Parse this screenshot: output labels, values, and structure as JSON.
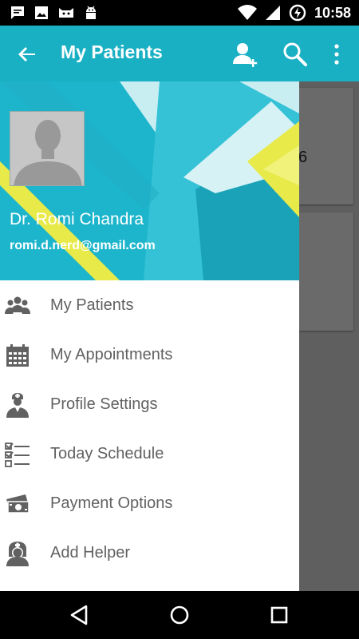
{
  "status_bar": {
    "time": "10:58",
    "left_icons": [
      "chat-icon",
      "image-icon",
      "cat-icon",
      "android-icon"
    ],
    "right_icons": [
      "wifi-icon",
      "signal-icon",
      "battery-charging-icon"
    ]
  },
  "app_bar": {
    "title": "My Patients",
    "actions": [
      "add-user-icon",
      "search-icon",
      "overflow-menu-icon"
    ]
  },
  "background": {
    "card_text": "6"
  },
  "drawer": {
    "profile": {
      "name": "Dr. Romi Chandra",
      "email": "romi.d.nerd@gmail.com"
    },
    "items": [
      {
        "label": "My Patients",
        "icon": "patients-group-icon"
      },
      {
        "label": "My Appointments",
        "icon": "calendar-icon"
      },
      {
        "label": "Profile Settings",
        "icon": "doctor-icon"
      },
      {
        "label": "Today Schedule",
        "icon": "checklist-icon"
      },
      {
        "label": "Payment Options",
        "icon": "money-icon"
      },
      {
        "label": "Add Helper",
        "icon": "nurse-icon"
      }
    ]
  },
  "nav_bar": {
    "buttons": [
      "back-icon",
      "home-icon",
      "recents-icon"
    ]
  },
  "colors": {
    "primary": "#1ab0c4",
    "icon_gray": "#616161",
    "accent_yellow": "#e8ea4a"
  }
}
